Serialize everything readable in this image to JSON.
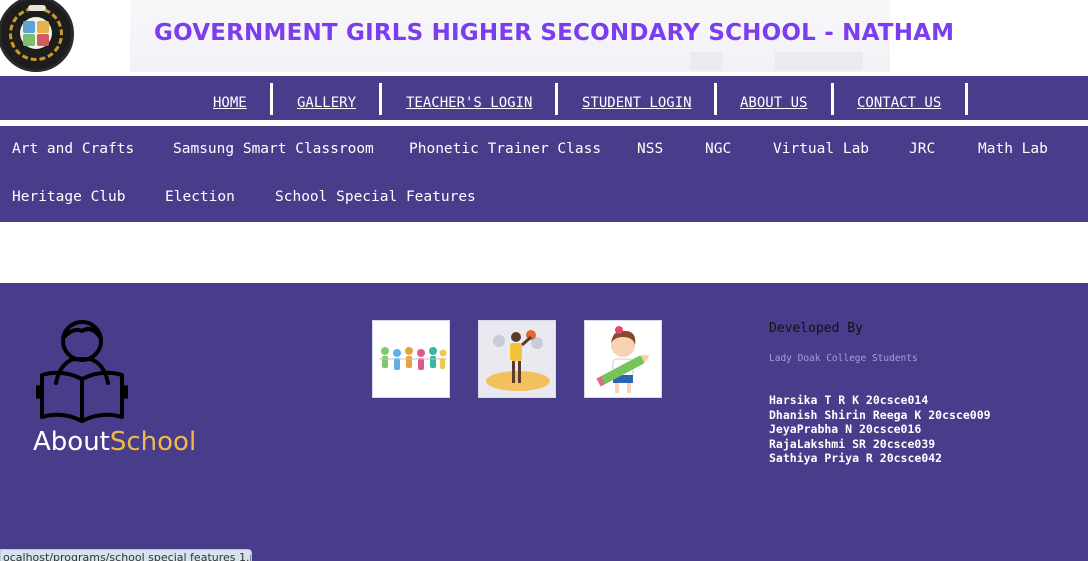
{
  "header": {
    "title": "GOVERNMENT GIRLS HIGHER SECONDARY SCHOOL - NATHAM",
    "logo_icon": "school-emblem-icon"
  },
  "topnav": {
    "items": [
      {
        "label": "HOME"
      },
      {
        "label": "GALLERY"
      },
      {
        "label": "TEACHER'S LOGIN"
      },
      {
        "label": "STUDENT LOGIN"
      },
      {
        "label": "ABOUT US"
      },
      {
        "label": "CONTACT US"
      }
    ]
  },
  "categories": [
    "Art and Crafts",
    "Samsung Smart Classroom",
    "Phonetic Trainer Class",
    "NSS",
    "NGC",
    "Virtual Lab",
    "JRC",
    "Math Lab",
    "Heritage Club",
    "Election",
    "School Special Features"
  ],
  "footer": {
    "about_part1": "About",
    "about_part2": "School",
    "reader_icon": "reading-student-icon",
    "thumbnails": [
      "children-holding-hands-image",
      "sports-player-image",
      "girl-with-pencil-image"
    ],
    "developed_by": "Developed By",
    "developers_subtitle": "Lady Doak College Students",
    "developers": [
      "Harsika T R K 20csce014",
      "Dhanish Shirin Reega K 20csce009",
      "JeyaPrabha N 20csce016",
      "RajaLakshmi SR 20csce039",
      "Sathiya Priya R 20csce042"
    ]
  },
  "status_bar": {
    "url": "ocalhost/programs/school special features 1.pdf"
  },
  "colors": {
    "nav_bg": "#483d8b",
    "title_purple": "#7a3df0",
    "about_accent": "#f0b94a"
  }
}
